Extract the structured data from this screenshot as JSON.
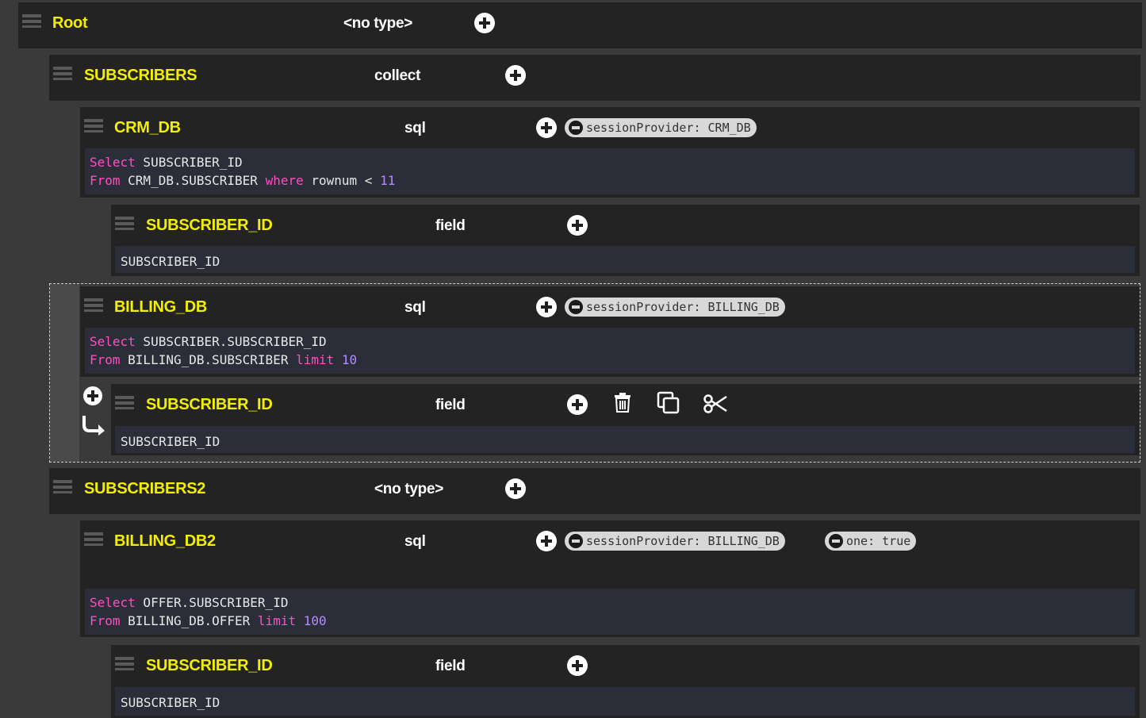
{
  "root": {
    "name": "Root",
    "type": "<no type>"
  },
  "subscribers": {
    "name": "SUBSCRIBERS",
    "type": "collect"
  },
  "crm_db": {
    "name": "CRM_DB",
    "type": "sql",
    "pill": "sessionProvider: CRM_DB",
    "code": {
      "l1_kw": "Select",
      "l1_rest": " SUBSCRIBER_ID",
      "l2_kw": "From",
      "l2_mid": " CRM_DB.SUBSCRIBER ",
      "l2_kw2": "where",
      "l2_rest": " rownum < ",
      "l2_num": "11"
    }
  },
  "crm_field": {
    "name": "SUBSCRIBER_ID",
    "type": "field",
    "value": "SUBSCRIBER_ID"
  },
  "billing_db": {
    "name": "BILLING_DB",
    "type": "sql",
    "pill": "sessionProvider: BILLING_DB",
    "code": {
      "l1_kw": "Select",
      "l1_rest": " SUBSCRIBER.SUBSCRIBER_ID",
      "l2_kw": "From",
      "l2_mid": " BILLING_DB.SUBSCRIBER ",
      "l2_kw2": "limit",
      "l2_num": " 10"
    }
  },
  "billing_field": {
    "name": "SUBSCRIBER_ID",
    "type": "field",
    "value": "SUBSCRIBER_ID"
  },
  "subscribers2": {
    "name": "SUBSCRIBERS2",
    "type": "<no type>"
  },
  "billing_db2": {
    "name": "BILLING_DB2",
    "type": "sql",
    "pill1": "sessionProvider: BILLING_DB",
    "pill2": "one: true",
    "code": {
      "l1_kw": "Select",
      "l1_rest": " OFFER.SUBSCRIBER_ID",
      "l2_kw": "From",
      "l2_mid": " BILLING_DB.OFFER ",
      "l2_kw2": "limit",
      "l2_num": " 100"
    }
  },
  "billing2_field": {
    "name": "SUBSCRIBER_ID",
    "type": "field",
    "value": "SUBSCRIBER_ID"
  },
  "toolbar_icons": [
    "plus-icon",
    "trash-icon",
    "copy-icon",
    "scissors-icon"
  ],
  "side_icons": [
    "plus-icon",
    "indent-arrow-icon"
  ]
}
